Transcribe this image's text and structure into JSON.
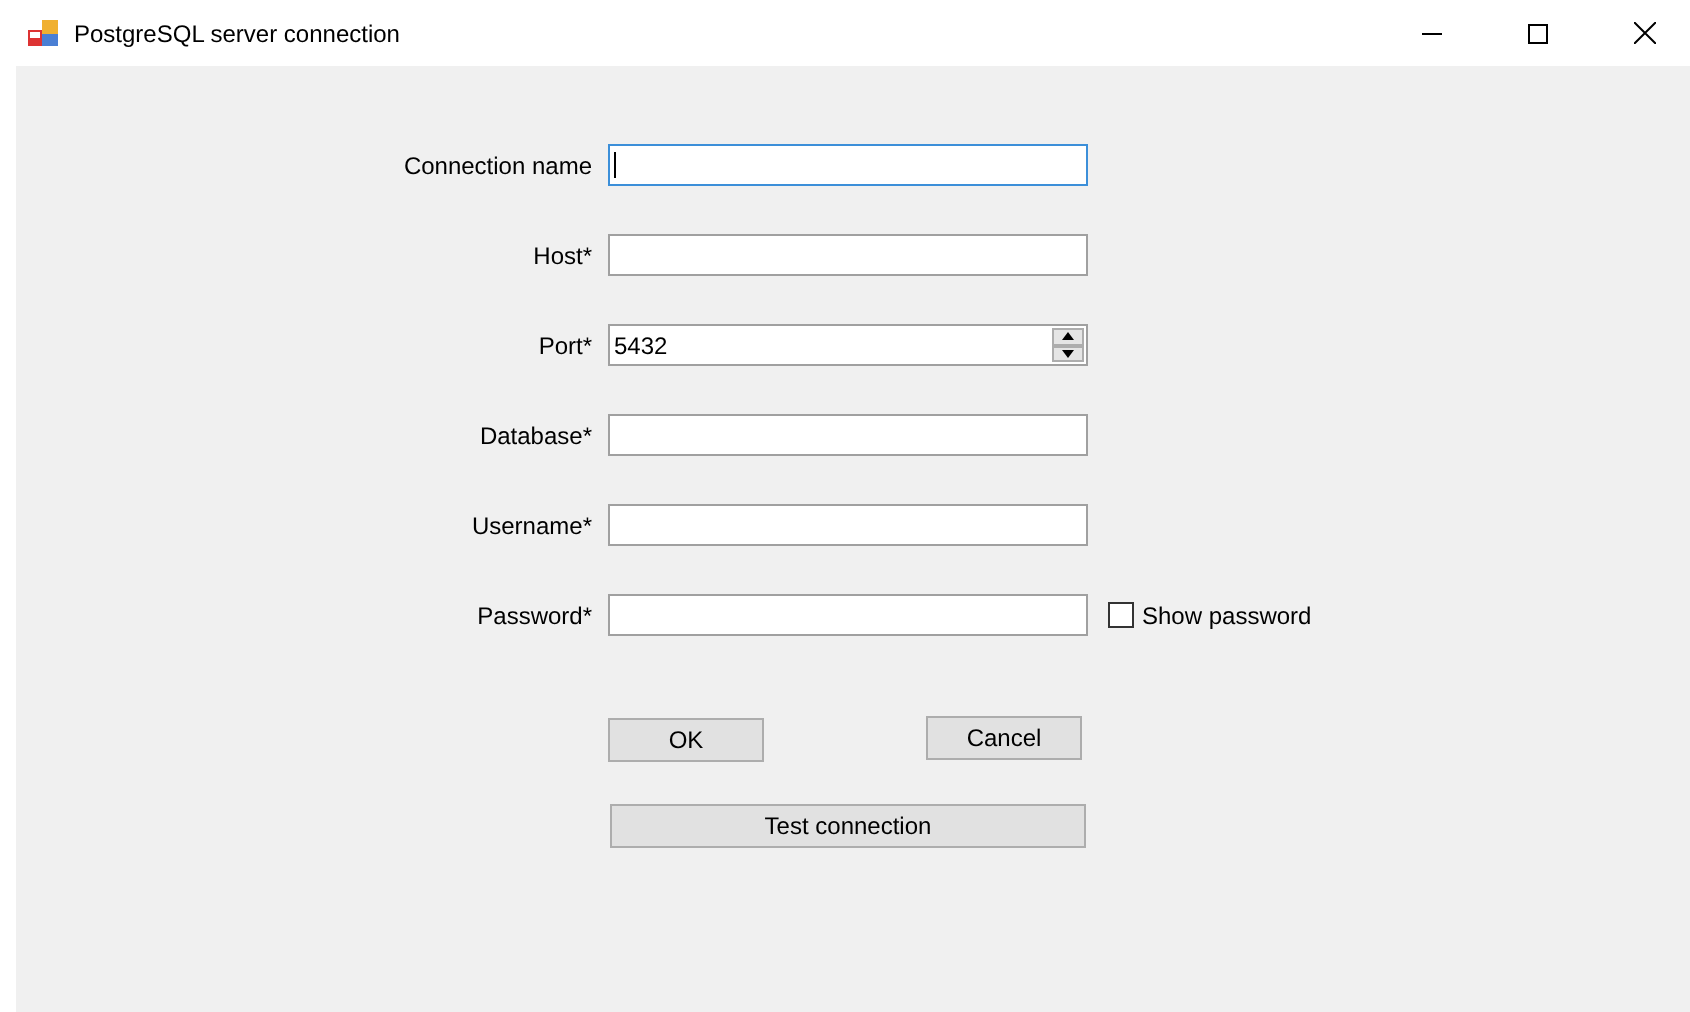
{
  "window": {
    "title": "PostgreSQL server connection"
  },
  "fields": [
    {
      "label": "Connection name",
      "kind": "text",
      "focused": true
    },
    {
      "label": "Host*",
      "kind": "text",
      "focused": false
    },
    {
      "label": "Port*",
      "kind": "spin",
      "value": "5432",
      "focused": false
    },
    {
      "label": "Database*",
      "kind": "text",
      "focused": false
    },
    {
      "label": "Username*",
      "kind": "text",
      "focused": false
    },
    {
      "label": "Password*",
      "kind": "password",
      "focused": false,
      "checkbox": {
        "label": "Show password",
        "checked": false
      }
    }
  ],
  "buttons": [
    {
      "label": "OK",
      "kind": "ok"
    },
    {
      "label": "Cancel",
      "kind": "cancel"
    },
    {
      "label": "Test connection",
      "kind": "wide"
    }
  ]
}
